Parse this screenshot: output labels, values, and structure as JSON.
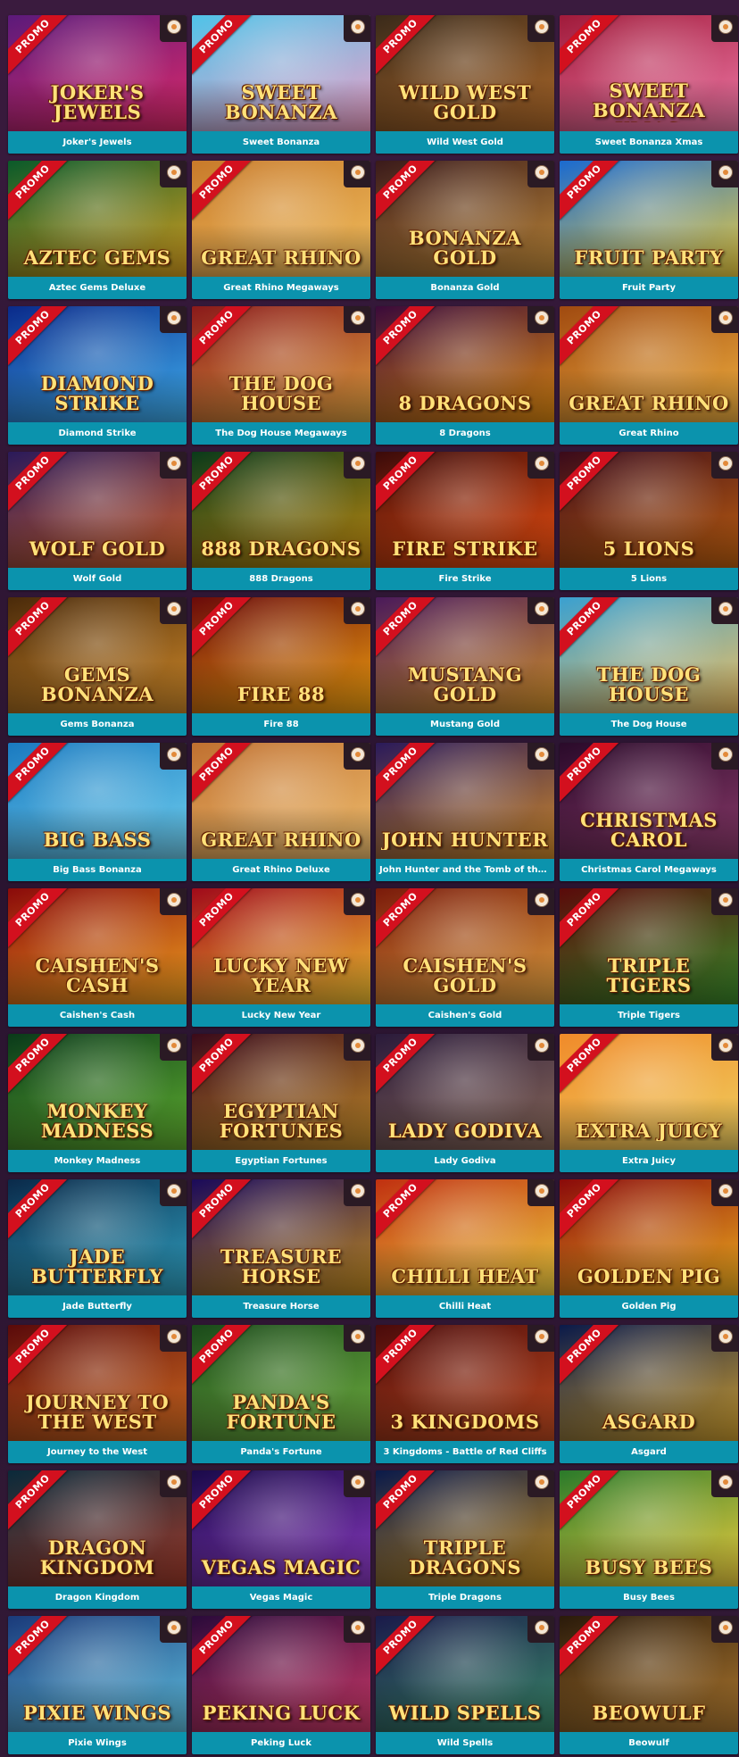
{
  "promo_label": "PROMO",
  "games": [
    {
      "title": "Joker's Jewels",
      "logo": "Joker's Jewels",
      "c1": "#5b1a7a",
      "c2": "#e02a6a",
      "promo": true
    },
    {
      "title": "Sweet Bonanza",
      "logo": "Sweet Bonanza",
      "c1": "#4fc3e8",
      "c2": "#f2a0c8",
      "promo": true
    },
    {
      "title": "Wild West Gold",
      "logo": "Wild West Gold",
      "c1": "#3a2a1a",
      "c2": "#b06a2a",
      "promo": true
    },
    {
      "title": "Sweet Bonanza Xmas",
      "logo": "Sweet Bonanza Xmas",
      "c1": "#a01a3a",
      "c2": "#f07aa8",
      "promo": true
    },
    {
      "title": "Aztec Gems Deluxe",
      "logo": "Aztec Gems",
      "c1": "#0a5a2a",
      "c2": "#d8a020",
      "promo": true
    },
    {
      "title": "Great Rhino Megaways",
      "logo": "Great Rhino",
      "c1": "#c87a2a",
      "c2": "#f2c060",
      "promo": true
    },
    {
      "title": "Bonanza Gold",
      "logo": "Bonanza Gold",
      "c1": "#3a1a1a",
      "c2": "#c08a3a",
      "promo": true
    },
    {
      "title": "Fruit Party",
      "logo": "Fruit Party",
      "c1": "#1a6ad0",
      "c2": "#f0d040",
      "promo": true
    },
    {
      "title": "Diamond Strike",
      "logo": "Diamond Strike",
      "c1": "#0a2a8a",
      "c2": "#40b0f0",
      "promo": true
    },
    {
      "title": "The Dog House Megaways",
      "logo": "The Dog House",
      "c1": "#8a1a1a",
      "c2": "#e0a040",
      "promo": true
    },
    {
      "title": "8 Dragons",
      "logo": "8 Dragons",
      "c1": "#3a0a3a",
      "c2": "#e08a10",
      "promo": true
    },
    {
      "title": "Great Rhino",
      "logo": "Great Rhino",
      "c1": "#a04a10",
      "c2": "#f0b040",
      "promo": true
    },
    {
      "title": "Wolf Gold",
      "logo": "Wolf Gold",
      "c1": "#2a1a5a",
      "c2": "#d0602a",
      "promo": true
    },
    {
      "title": "888 Dragons",
      "logo": "888 Dragons",
      "c1": "#0a3a1a",
      "c2": "#c08a10",
      "promo": true
    },
    {
      "title": "Fire Strike",
      "logo": "Fire Strike",
      "c1": "#3a0a0a",
      "c2": "#f05010",
      "promo": true
    },
    {
      "title": "5 Lions",
      "logo": "5 Lions",
      "c1": "#3a0a1a",
      "c2": "#c06010",
      "promo": true
    },
    {
      "title": "Gems Bonanza",
      "logo": "Gems Bonanza",
      "c1": "#4a2a0a",
      "c2": "#d08a2a",
      "promo": true
    },
    {
      "title": "Fire 88",
      "logo": "Fire 88",
      "c1": "#6a0a0a",
      "c2": "#f0a010",
      "promo": true
    },
    {
      "title": "Mustang Gold",
      "logo": "Mustang Gold",
      "c1": "#4a1a5a",
      "c2": "#d0902a",
      "promo": true
    },
    {
      "title": "The Dog House",
      "logo": "The Dog House",
      "c1": "#3aa0d0",
      "c2": "#f0c060",
      "promo": true
    },
    {
      "title": "Big Bass Bonanza",
      "logo": "Big Bass",
      "c1": "#1a7ac0",
      "c2": "#70d0f0",
      "promo": true
    },
    {
      "title": "Great Rhino Deluxe",
      "logo": "Great Rhino",
      "c1": "#c07030",
      "c2": "#f0c070",
      "promo": true
    },
    {
      "title": "John Hunter and the Tomb of the Scarab Queen",
      "logo": "John Hunter",
      "c1": "#2a1a5a",
      "c2": "#d08a2a",
      "promo": true
    },
    {
      "title": "Christmas Carol Megaways",
      "logo": "Christmas Carol",
      "c1": "#2a0a2a",
      "c2": "#8a3a6a",
      "promo": true
    },
    {
      "title": "Caishen's Cash",
      "logo": "Caishen's Cash",
      "c1": "#8a0a0a",
      "c2": "#f0a020",
      "promo": true
    },
    {
      "title": "Lucky New Year",
      "logo": "Lucky New Year",
      "c1": "#a00a1a",
      "c2": "#f0c030",
      "promo": true
    },
    {
      "title": "Caishen's Gold",
      "logo": "Caishen's Gold",
      "c1": "#7a1a0a",
      "c2": "#e0a040",
      "promo": true
    },
    {
      "title": "Triple Tigers",
      "logo": "Triple Tigers",
      "c1": "#5a0a0a",
      "c2": "#3a8a2a",
      "promo": true
    },
    {
      "title": "Monkey Madness",
      "logo": "Monkey Madness",
      "c1": "#0a3a1a",
      "c2": "#60b030",
      "promo": true
    },
    {
      "title": "Egyptian Fortunes",
      "logo": "Egyptian Fortunes",
      "c1": "#3a0a1a",
      "c2": "#c08a2a",
      "promo": true
    },
    {
      "title": "Lady Godiva",
      "logo": "Lady Godiva",
      "c1": "#2a1a3a",
      "c2": "#8a6a5a",
      "promo": true
    },
    {
      "title": "Extra Juicy",
      "logo": "Extra Juicy",
      "c1": "#f08a2a",
      "c2": "#f0d060",
      "promo": true
    },
    {
      "title": "Jade Butterfly",
      "logo": "Jade Butterfly",
      "c1": "#0a2a4a",
      "c2": "#30a0c0",
      "promo": true
    },
    {
      "title": "Treasure Horse",
      "logo": "Treasure Horse",
      "c1": "#1a0a5a",
      "c2": "#c08a20",
      "promo": true
    },
    {
      "title": "Chilli Heat",
      "logo": "Chilli Heat",
      "c1": "#c03010",
      "c2": "#f0d040",
      "promo": true
    },
    {
      "title": "Golden Pig",
      "logo": "Golden Pig",
      "c1": "#8a0a0a",
      "c2": "#f0b020",
      "promo": true
    },
    {
      "title": "Journey to the West",
      "logo": "Journey to the West",
      "c1": "#5a0a0a",
      "c2": "#d06a20",
      "promo": true
    },
    {
      "title": "Panda's Fortune",
      "logo": "Panda's Fortune",
      "c1": "#1a4a1a",
      "c2": "#70b040",
      "promo": true
    },
    {
      "title": "3 Kingdoms - Battle of Red Cliffs",
      "logo": "3 Kingdoms",
      "c1": "#4a0a0a",
      "c2": "#c04a20",
      "promo": true
    },
    {
      "title": "Asgard",
      "logo": "Asgard",
      "c1": "#0a1a4a",
      "c2": "#d0a030",
      "promo": true
    },
    {
      "title": "Dragon Kingdom",
      "logo": "Dragon Kingdom",
      "c1": "#0a2a3a",
      "c2": "#a03a2a",
      "promo": true
    },
    {
      "title": "Vegas Magic",
      "logo": "Vegas Magic",
      "c1": "#1a0a4a",
      "c2": "#8a3ac0",
      "promo": true
    },
    {
      "title": "Triple Dragons",
      "logo": "Triple Dragons",
      "c1": "#0a1a4a",
      "c2": "#c08a20",
      "promo": true
    },
    {
      "title": "Busy Bees",
      "logo": "Busy Bees",
      "c1": "#2a7a2a",
      "c2": "#f0d040",
      "promo": true
    },
    {
      "title": "Pixie Wings",
      "logo": "Pixie Wings",
      "c1": "#1a3a7a",
      "c2": "#60c0e0",
      "promo": true
    },
    {
      "title": "Peking Luck",
      "logo": "Peking Luck",
      "c1": "#2a0a3a",
      "c2": "#d03a6a",
      "promo": true
    },
    {
      "title": "Wild Spells",
      "logo": "Wild Spells",
      "c1": "#1a1a4a",
      "c2": "#3a8a6a",
      "promo": true
    },
    {
      "title": "Beowulf",
      "logo": "Beowulf",
      "c1": "#2a1a0a",
      "c2": "#b07a30",
      "promo": true
    }
  ]
}
